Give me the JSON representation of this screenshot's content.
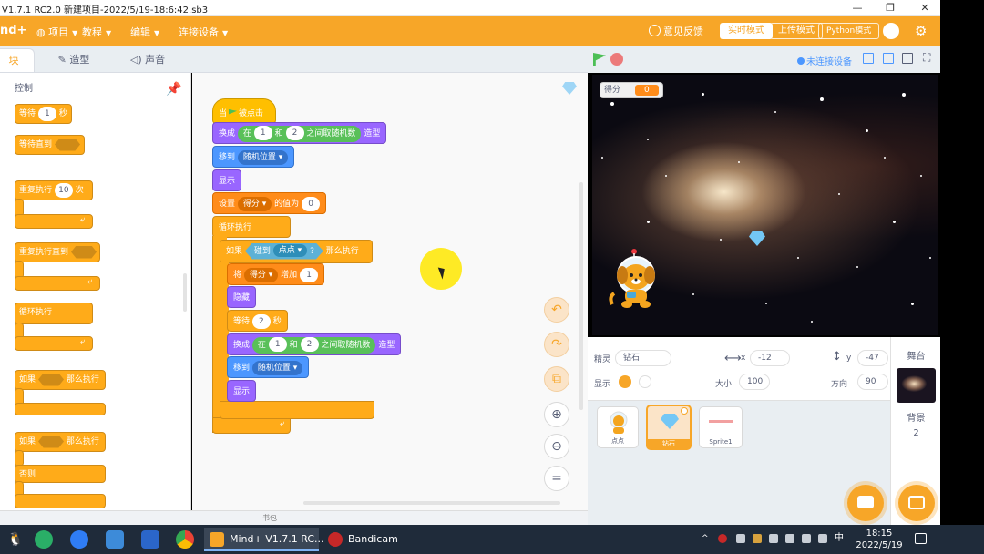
{
  "titlebar": {
    "title": "V1.7.1 RC2.0   新建项目-2022/5/19-18:6:42.sb3"
  },
  "menubar": {
    "logo": "nd+",
    "items": [
      "项目",
      "教程",
      "编辑",
      "连接设备"
    ],
    "feedback": "意见反馈",
    "modes": [
      "实时模式",
      "上传模式",
      "Python模式"
    ]
  },
  "tabs": [
    "块",
    "造型",
    "声音"
  ],
  "palette": {
    "category": "控制",
    "blocks": {
      "wait": "等待",
      "wait_val": "1",
      "wait_unit": "秒",
      "wait_until": "等待直到",
      "repeat": "重复执行",
      "repeat_val": "10",
      "repeat_unit": "次",
      "repeat_until": "重复执行直到",
      "forever": "循环执行",
      "if": "如果",
      "then": "那么执行",
      "if2": "如果",
      "then2": "那么执行",
      "else": "否则"
    }
  },
  "script": {
    "hat": "当",
    "hat_clicked": "被点击",
    "switch_costume": "换成",
    "in": "在",
    "rand_a": "1",
    "and": "和",
    "rand_b": "2",
    "rand_between": "之间取随机数",
    "costume": "造型",
    "goto": "移到",
    "random_pos": "随机位置",
    "show": "显示",
    "set": "设置",
    "var_score": "得分",
    "to": "的值为",
    "set_val": "0",
    "forever": "循环执行",
    "if": "如果",
    "touching": "碰到",
    "target": "点点",
    "question": "?",
    "then": "那么执行",
    "change": "将",
    "change_var": "得分",
    "by": "增加",
    "change_val": "1",
    "hide": "隐藏",
    "wait": "等待",
    "wait_val": "2",
    "wait_unit": "秒",
    "switch2": "换成",
    "in2": "在",
    "rand2_a": "1",
    "and2": "和",
    "rand2_b": "2",
    "rand2_between": "之间取随机数",
    "costume2": "造型",
    "goto2": "移到",
    "random_pos2": "随机位置",
    "show2": "显示"
  },
  "bottom": {
    "label": "书包"
  },
  "stage_header": {
    "connection": "未连接设备"
  },
  "stage": {
    "monitor_label": "得分",
    "monitor_value": "0"
  },
  "sprite_info": {
    "sprite_label": "精灵",
    "sprite_name": "钻石",
    "x_label": "x",
    "x_value": "-12",
    "y_label": "y",
    "y_value": "-47",
    "show_label": "显示",
    "size_label": "大小",
    "size_value": "100",
    "dir_label": "方向",
    "dir_value": "90"
  },
  "sprites": [
    {
      "name": "点点"
    },
    {
      "name": "钻石"
    },
    {
      "name": "Sprite1"
    }
  ],
  "stage_pane": {
    "title": "舞台",
    "backdrop_label": "背景",
    "backdrop_count": "2"
  },
  "taskbar": {
    "tasks": [
      "Mind+ V1.7.1 RC...",
      "Bandicam"
    ],
    "time": "18:15",
    "date": "2022/5/19"
  },
  "colors": {
    "accent": "#f7a628",
    "motion": "#4c97ff",
    "looks": "#9966ff",
    "control": "#ffab19",
    "operators": "#59c059",
    "sensing": "#5cb1d6",
    "variables": "#ff8c1a"
  }
}
